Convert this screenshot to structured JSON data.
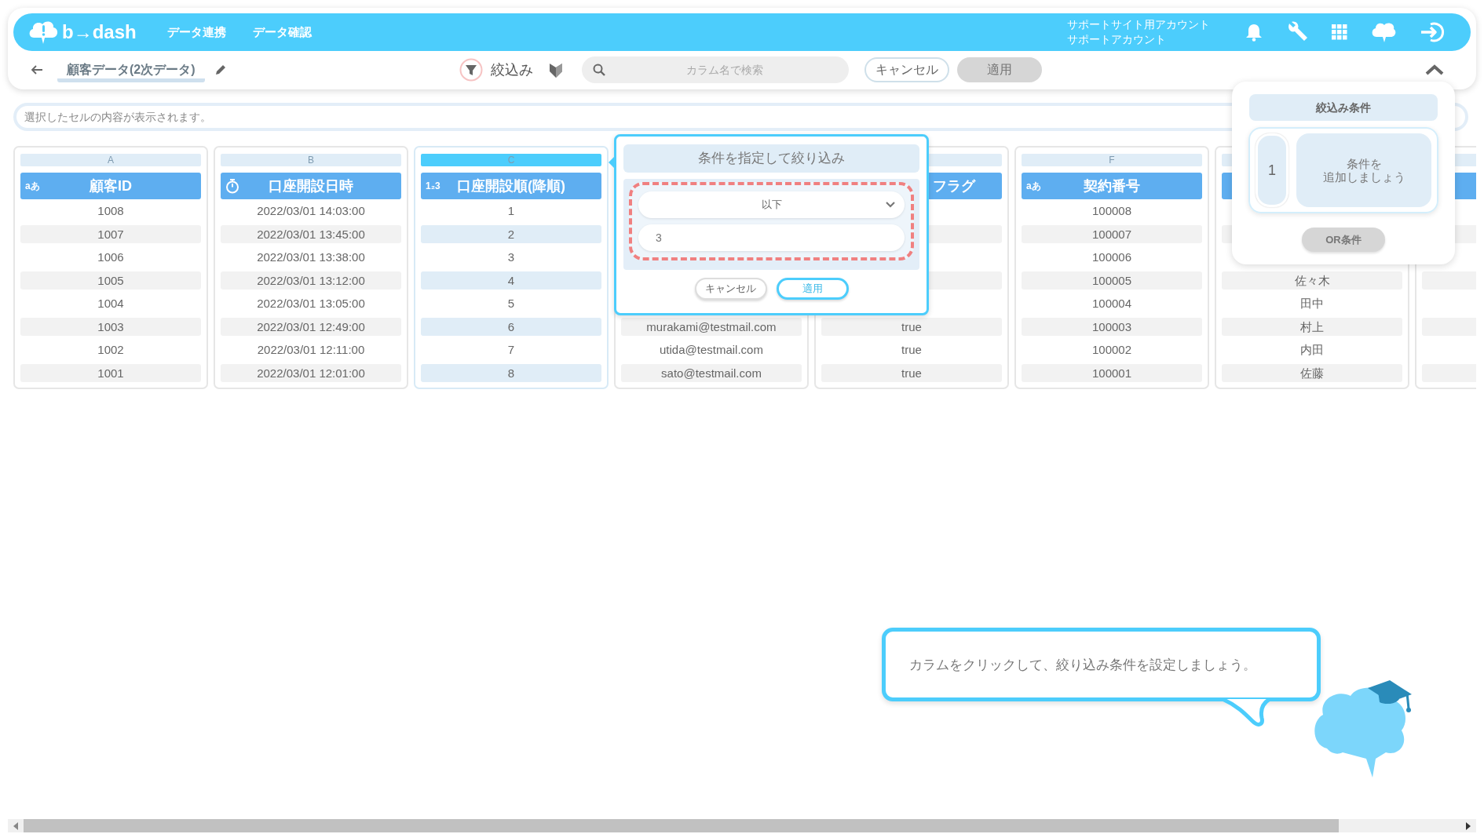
{
  "header": {
    "logo": "b→dash",
    "nav": [
      {
        "label": "データ連携"
      },
      {
        "label": "データ確認"
      }
    ],
    "account": [
      "サポートサイト用アカウント",
      "サポートアカウント"
    ]
  },
  "toolbar": {
    "title": "顧客データ(2次データ)",
    "filter_label": "絞込み",
    "search": {
      "placeholder": "カラム名で検索"
    },
    "cancel": "キャンセル",
    "apply": {
      "label": "適用",
      "disabled": true
    }
  },
  "cell_viewer": {
    "placeholder": "選択したセルの内容が表示されます。"
  },
  "columns": [
    {
      "letter": "A",
      "kind": "text",
      "type_mark": "aあ",
      "name": "顧客ID",
      "selected": false,
      "cells": [
        "1008",
        "1007",
        "1006",
        "1005",
        "1004",
        "1003",
        "1002",
        "1001"
      ]
    },
    {
      "letter": "B",
      "kind": "datetime",
      "name": "口座開設日時",
      "selected": false,
      "cells": [
        "2022/03/01 14:03:00",
        "2022/03/01 13:45:00",
        "2022/03/01 13:38:00",
        "2022/03/01 13:12:00",
        "2022/03/01 13:05:00",
        "2022/03/01 12:49:00",
        "2022/03/01 12:11:00",
        "2022/03/01 12:01:00"
      ]
    },
    {
      "letter": "C",
      "kind": "number",
      "type_mark": "1₂3",
      "name": "口座開設順(降順)",
      "selected": true,
      "cells": [
        "1",
        "2",
        "3",
        "4",
        "5",
        "6",
        "7",
        "8"
      ]
    },
    {
      "selected": false,
      "cells": [
        null,
        null,
        null,
        null,
        null,
        "murakami@testmail.com",
        "utida@testmail.com",
        "sato@testmail.com"
      ]
    },
    {
      "name": "フラグ",
      "name_cut": true,
      "selected": false,
      "cells": [
        null,
        null,
        null,
        null,
        null,
        "true",
        "true",
        "true"
      ]
    },
    {
      "letter": "F",
      "kind": "text",
      "type_mark": "aあ",
      "name": "契約番号",
      "selected": false,
      "cells": [
        "100008",
        "100007",
        "100006",
        "100005",
        "100004",
        "100003",
        "100002",
        "100001"
      ]
    },
    {
      "selected": false,
      "cells": [
        null,
        null,
        null,
        "佐々木",
        "田中",
        "村上",
        "内田",
        "佐藤"
      ]
    },
    {
      "selected": false
    }
  ],
  "filter_popup": {
    "title": "条件を指定して絞り込み",
    "operator": "以下",
    "value": "3",
    "cancel": "キャンセル",
    "apply": "適用"
  },
  "conditions_panel": {
    "title": "絞込み条件",
    "groups": [
      {
        "number": "1",
        "lines": [
          "条件を",
          "追加しましょう"
        ]
      }
    ],
    "or_button": {
      "label": "OR条件",
      "disabled": true
    }
  },
  "hint": {
    "text": "カラムをクリックして、絞り込み条件を設定しましょう。"
  }
}
